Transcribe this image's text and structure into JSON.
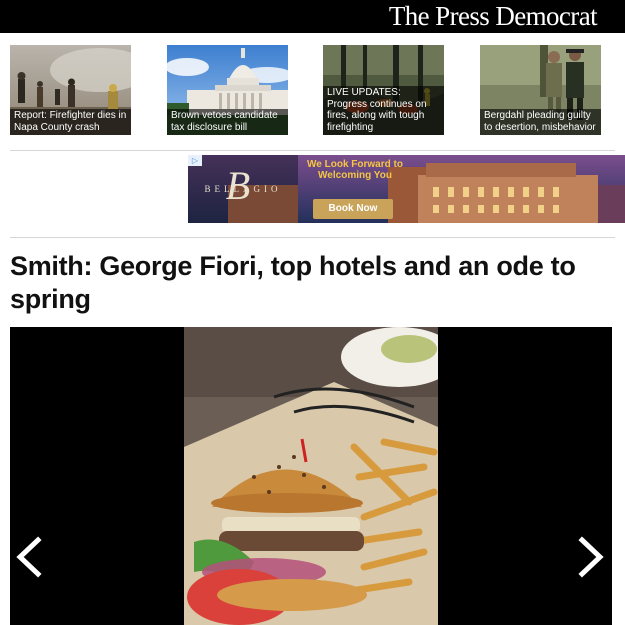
{
  "masthead": {
    "title": "The Press Democrat"
  },
  "headlines": [
    {
      "caption": "Report: Firefighter dies in Napa County crash",
      "image": "firefighter-photo"
    },
    {
      "caption": "Brown vetoes candidate tax disclosure bill",
      "image": "capitol-photo"
    },
    {
      "caption": "LIVE UPDATES: Progress continues on fires, along with tough firefighting",
      "image": "fire-forest-photo"
    },
    {
      "caption": "Bergdahl pleading guilty to desertion, misbehavior",
      "image": "soldiers-photo"
    }
  ],
  "ad": {
    "badge": "▷",
    "logo_initial": "B",
    "logo": "BELLAGIO",
    "headline": "We Look Forward to Welcoming You",
    "cta": "Book Now"
  },
  "article": {
    "title": "Smith: George Fiori, top hotels and an ode to spring",
    "gallery": {
      "image": "burger-and-fries-photo",
      "prev_icon": "chevron-left-icon",
      "next_icon": "chevron-right-icon"
    }
  },
  "colors": {
    "masthead_bg": "#000000",
    "ad_gold": "#f5c543",
    "ad_button": "#c9a35a",
    "gallery_bg": "#000000"
  }
}
